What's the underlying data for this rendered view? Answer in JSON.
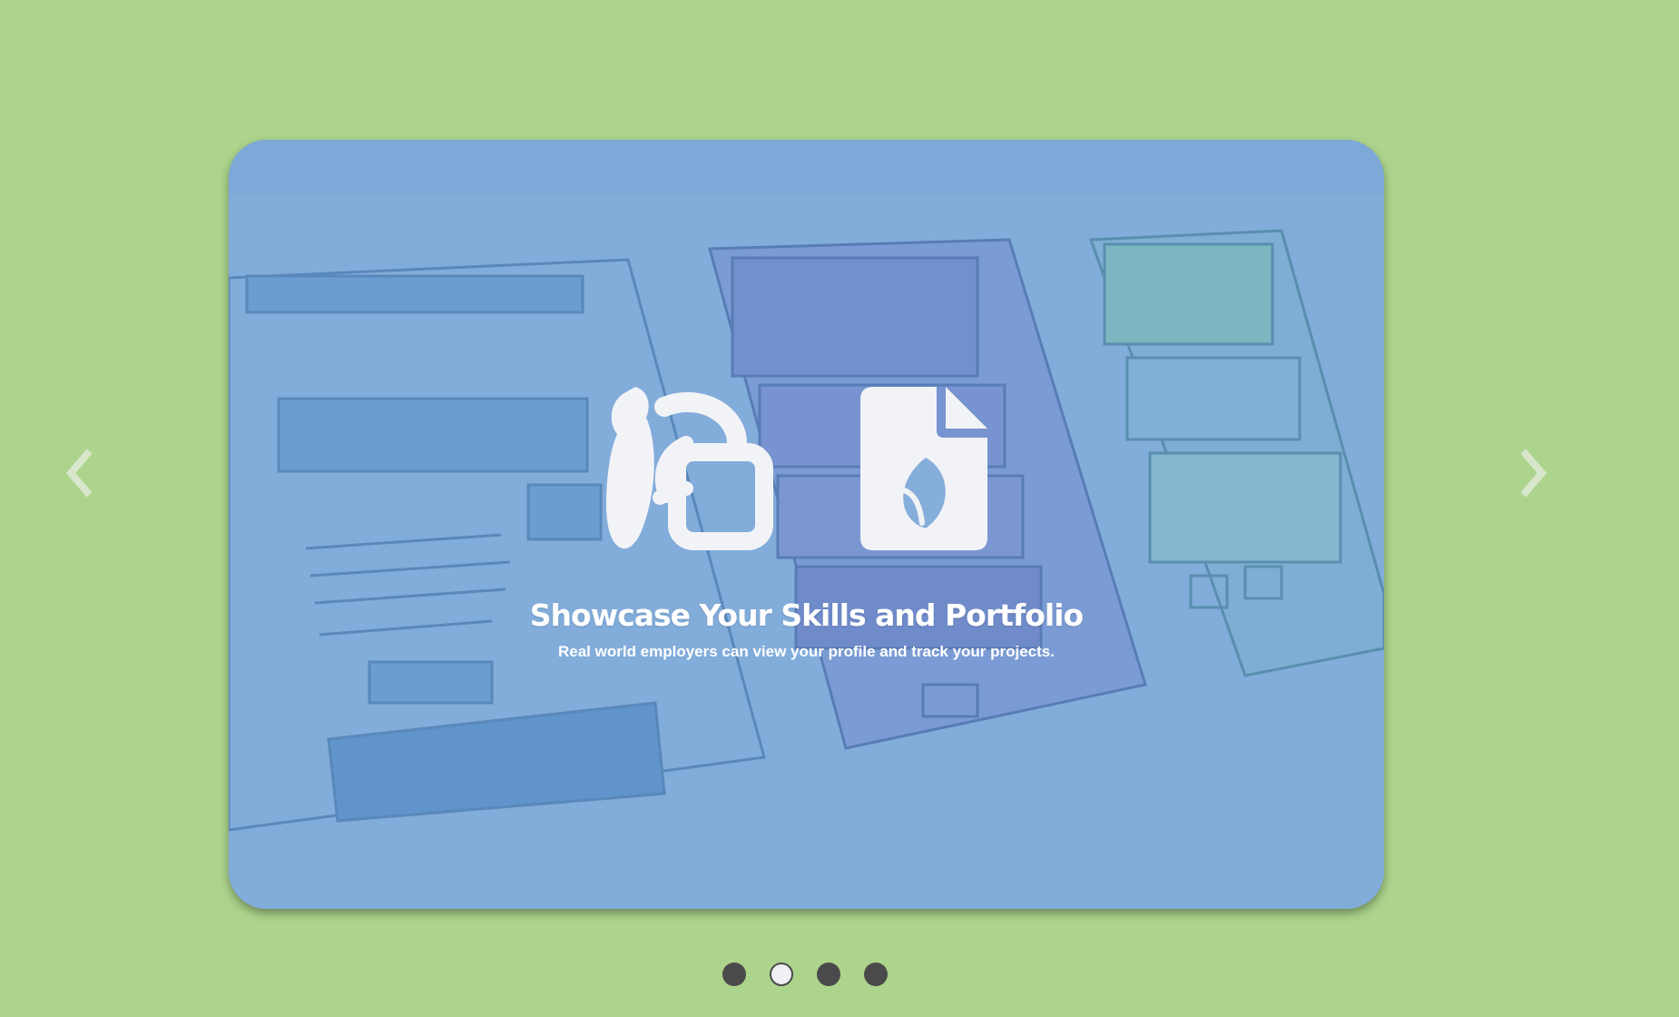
{
  "carousel": {
    "slide": {
      "title": "Showcase Your Skills and Portfolio",
      "subtitle": "Real world employers can view your profile and track your projects.",
      "icons": [
        "design-tools-icon",
        "document-leaf-icon"
      ],
      "background": "wireframe-sketches-image"
    },
    "controls": {
      "prev_icon": "chevron-left-icon",
      "next_icon": "chevron-right-icon"
    },
    "indicators": {
      "count": 4,
      "active_index": 1
    }
  },
  "colors": {
    "page_background": "#acd48c",
    "slide_tint": "#7ba8d8",
    "icon_color": "#f2f3f7",
    "dot_inactive": "#4a4a4a",
    "dot_active": "#eef0f4"
  }
}
